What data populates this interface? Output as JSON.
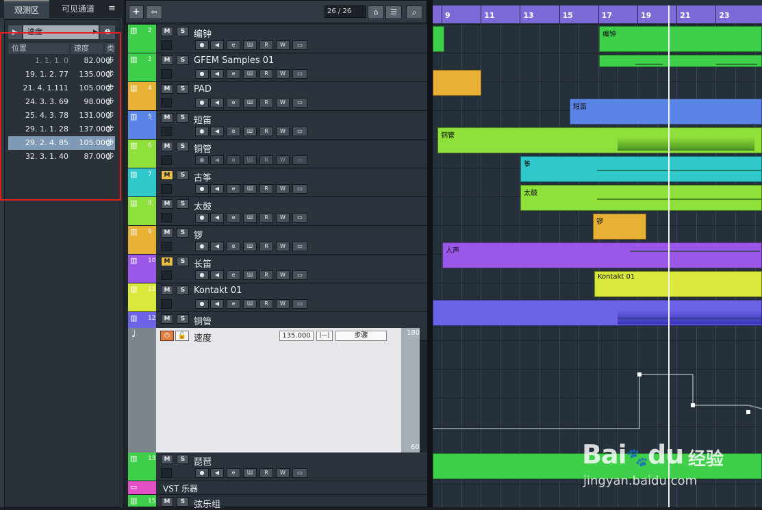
{
  "left_panel": {
    "tabs": [
      "观测区",
      "可见通道"
    ],
    "menu_icon": "hamburger-icon",
    "selector": "速度",
    "columns": [
      "位置",
      "速度",
      "类"
    ],
    "rows": [
      {
        "pos": "1. 1. 1.   0",
        "tempo": "82.000",
        "type": "步"
      },
      {
        "pos": "19. 1. 2. 77",
        "tempo": "135.000",
        "type": "步"
      },
      {
        "pos": "21. 4. 1.111",
        "tempo": "105.000",
        "type": "步"
      },
      {
        "pos": "24. 3. 3. 69",
        "tempo": "98.000",
        "type": "步"
      },
      {
        "pos": "25. 4. 3. 78",
        "tempo": "131.000",
        "type": "步"
      },
      {
        "pos": "29. 1. 1. 28",
        "tempo": "137.000",
        "type": "步"
      },
      {
        "pos": "29. 2. 4. 85",
        "tempo": "105.000",
        "type": "步"
      },
      {
        "pos": "32. 3. 1. 40",
        "tempo": "87.000",
        "type": "步"
      }
    ],
    "selected_row": 6,
    "highlight_color": "#e0211d"
  },
  "toolbar": {
    "count": "26 / 26"
  },
  "tracks": [
    {
      "num": "2",
      "name": "编钟",
      "color": "#3fcf4a",
      "solo": false,
      "mute_on": false
    },
    {
      "num": "3",
      "name": "GFEM Samples 01",
      "color": "#3fcf4a",
      "mute_on": false
    },
    {
      "num": "4",
      "name": "PAD",
      "color": "#e8b136",
      "mute_on": false
    },
    {
      "num": "5",
      "name": "短笛",
      "color": "#5a84e6",
      "mute_on": false
    },
    {
      "num": "6",
      "name": "铜管",
      "color": "#8ee03b",
      "mute_on": false,
      "dim": true
    },
    {
      "num": "7",
      "name": "古筝",
      "color": "#2fc9cb",
      "mute_on": true
    },
    {
      "num": "8",
      "name": "太鼓",
      "color": "#8ee03b",
      "mute_on": false
    },
    {
      "num": "9",
      "name": "锣",
      "color": "#e8b136",
      "mute_on": false
    },
    {
      "num": "10",
      "name": "长笛",
      "color": "#9a57e8",
      "mute_on": true
    },
    {
      "num": "11",
      "name": "Kontakt 01",
      "color": "#d9e83b",
      "mute_on": false
    },
    {
      "num": "12",
      "name": "铜管",
      "color": "#6d63e8",
      "mute_on": false
    }
  ],
  "track_buttons": {
    "mute": "M",
    "solo": "S",
    "record": "●",
    "monitor": "◀",
    "edit": "e",
    "instrument": "Ш",
    "read": "R",
    "write": "W",
    "more": "▭"
  },
  "tempo_track": {
    "name": "速度",
    "value": "135.000",
    "step_label": "步骤",
    "scale_max": "180",
    "scale_min": "60"
  },
  "bottom_tracks": [
    {
      "num": "13",
      "name": "琵琶",
      "color": "#3fcf4a"
    },
    {
      "name": "VST 乐器",
      "color": "#e54fc6"
    },
    {
      "num": "15",
      "name": "弦乐组",
      "color": "#3fcf4a"
    }
  ],
  "ruler": [
    "9",
    "11",
    "13",
    "15",
    "17",
    "19",
    "21",
    "23"
  ],
  "events": {
    "bianzhong": "编钟",
    "duandi": "短笛",
    "tongguan": "铜管",
    "zheng": "筝",
    "taigu": "太鼓",
    "luo": "锣",
    "rensheng": "人声",
    "kontakt": "Kontakt 01"
  },
  "watermark": {
    "brand": "Bai",
    "brand2": "du",
    "suffix": "经验",
    "url": "jingyan.baidu.com"
  }
}
